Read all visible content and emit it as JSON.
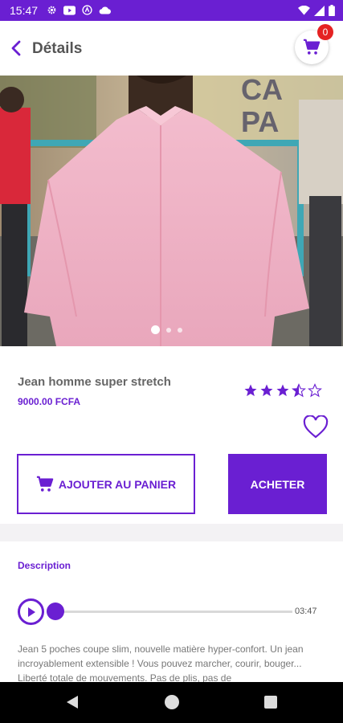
{
  "status_bar": {
    "time": "15:47"
  },
  "header": {
    "title": "Détails",
    "cart_count": "0"
  },
  "carousel": {
    "total": 3,
    "active": 0
  },
  "product": {
    "name": "Jean homme super stretch",
    "price": "9000.00 FCFA",
    "rating": 3.5,
    "rating_max": 5
  },
  "actions": {
    "add_to_cart_label": "AJOUTER AU PANIER",
    "buy_label": "ACHETER"
  },
  "description": {
    "title": "Description",
    "audio_duration": "03:47",
    "text": "Jean 5 poches coupe slim, nouvelle matière hyper-confort. Un jean incroyablement extensible ! Vous pouvez marcher, courir, bouger... Liberté totale de mouvements. Pas de plis, pas de"
  },
  "colors": {
    "accent": "#6a1fd2",
    "badge": "#e52222",
    "status_bar": "#6a1fd2"
  }
}
